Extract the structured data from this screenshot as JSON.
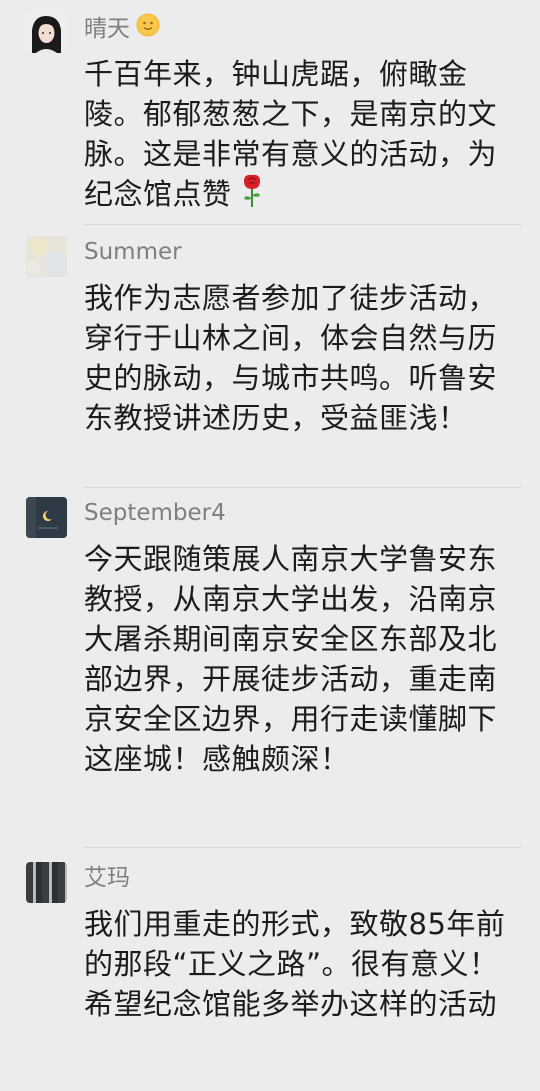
{
  "comments": [
    {
      "name": "晴天",
      "avatar": "avatar-girl-portrait",
      "name_icon": "sun-face-icon",
      "text": "千百年来，钟山虎踞，俯瞰金陵。郁郁葱葱之下，是南京的文脉。这是非常有意义的活动，为纪念馆点赞",
      "trailing_icon": "rose-icon"
    },
    {
      "name": "Summer",
      "avatar": "avatar-pastel-blur",
      "text": "我作为志愿者参加了徒步活动，穿行于山林之间，体会自然与历史的脉动，与城市共鸣。听鲁安东教授讲述历史，受益匪浅！"
    },
    {
      "name": "September4",
      "avatar": "avatar-dark-moon",
      "text": "今天跟随策展人南京大学鲁安东教授，从南京大学出发，沿南京大屠杀期间南京安全区东部及北部边界，开展徒步活动，重走南京安全区边界，用行走读懂脚下这座城！感触颇深！"
    },
    {
      "name": "艾玛",
      "avatar": "avatar-striped-curtain",
      "text": "我们用重走的形式，致敬85年前的那段“正义之路”。很有意义！希望纪念馆能多举办这样的活动"
    }
  ],
  "colors": {
    "background": "#ececec",
    "name": "#7f7f7f",
    "text": "#1c1c1c",
    "divider": "#d9d9d9"
  }
}
